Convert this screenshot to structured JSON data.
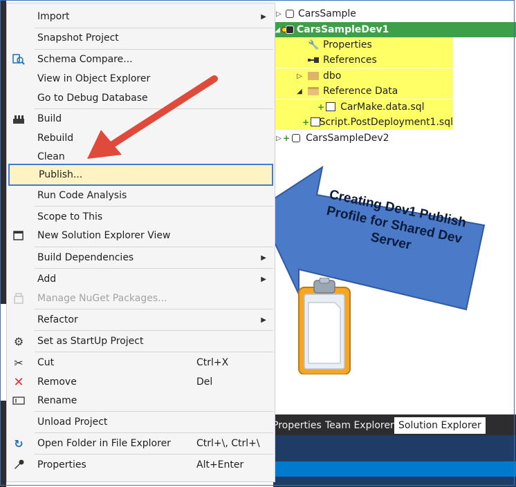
{
  "menu": {
    "items": [
      {
        "label": "Import",
        "icon": "",
        "submenu": true
      },
      {
        "label": "Snapshot Project",
        "icon": ""
      },
      {
        "label": "Schema Compare...",
        "icon": "schema-compare-icon"
      },
      {
        "label": "View in Object Explorer",
        "icon": ""
      },
      {
        "label": "Go to Debug Database",
        "icon": ""
      },
      {
        "label": "Build",
        "icon": "build-icon"
      },
      {
        "label": "Rebuild",
        "icon": ""
      },
      {
        "label": "Clean",
        "icon": ""
      },
      {
        "label": "Publish...",
        "icon": ""
      },
      {
        "label": "Run Code Analysis",
        "icon": ""
      },
      {
        "label": "Scope to This",
        "icon": ""
      },
      {
        "label": "New Solution Explorer View",
        "icon": "new-view-icon"
      },
      {
        "label": "Build Dependencies",
        "icon": "",
        "submenu": true
      },
      {
        "label": "Add",
        "icon": "",
        "submenu": true
      },
      {
        "label": "Manage NuGet Packages...",
        "icon": "nuget-icon",
        "disabled": true
      },
      {
        "label": "Refactor",
        "icon": "",
        "submenu": true
      },
      {
        "label": "Set as StartUp Project",
        "icon": "gear-icon"
      },
      {
        "label": "Cut",
        "icon": "scissors-icon",
        "shortcut": "Ctrl+X"
      },
      {
        "label": "Remove",
        "icon": "remove-x-icon",
        "shortcut": "Del"
      },
      {
        "label": "Rename",
        "icon": "rename-icon"
      },
      {
        "label": "Unload Project",
        "icon": ""
      },
      {
        "label": "Open Folder in File Explorer",
        "icon": "folder-refresh-icon",
        "shortcut": "Ctrl+\\, Ctrl+\\"
      },
      {
        "label": "Properties",
        "icon": "wrench-icon",
        "shortcut": "Alt+Enter"
      }
    ]
  },
  "tree": {
    "nodes": [
      {
        "label": "CarsSample"
      },
      {
        "label": "CarsSampleDev1"
      },
      {
        "label": "Properties"
      },
      {
        "label": "References"
      },
      {
        "label": "dbo"
      },
      {
        "label": "Reference Data"
      },
      {
        "label": "CarMake.data.sql"
      },
      {
        "label": "Script.PostDeployment1.sql"
      },
      {
        "label": "CarsSampleDev2"
      }
    ]
  },
  "tabs": [
    "Properties",
    "Team Explorer",
    "Solution Explorer"
  ],
  "callout": {
    "text": "Creating Dev1 Publish Profile for Shared Dev Server"
  },
  "colors": {
    "accent": "#3e7bd6",
    "selection": "#3da049",
    "highlight": "#ffff66",
    "arrow": "#e04a3a",
    "callout": "#4a7ac8"
  }
}
